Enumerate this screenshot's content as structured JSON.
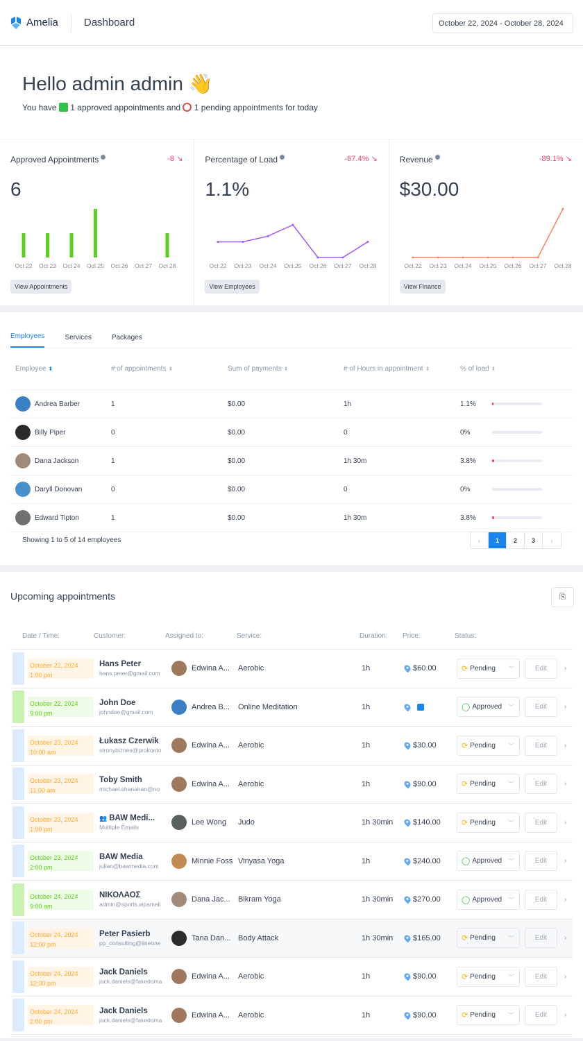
{
  "header": {
    "logo_text": "Amelia",
    "title": "Dashboard",
    "date_range": "October 22, 2024 - October 28, 2024"
  },
  "hello": {
    "greeting": "Hello admin admin",
    "wave": "👋",
    "line_start": "You have",
    "approved_text": "1 approved appointments and",
    "pending_text": "1 pending appointments for today"
  },
  "cards": [
    {
      "title": "Approved Appointments",
      "trend": "-8",
      "value": "6",
      "button": "View Appointments"
    },
    {
      "title": "Percentage of Load",
      "trend": "-67.4%",
      "value": "1.1%",
      "button": "View Employees"
    },
    {
      "title": "Revenue",
      "trend": "-89.1%",
      "value": "$30.00",
      "button": "View Finance"
    }
  ],
  "chart_data": [
    {
      "type": "bar",
      "title": "Approved Appointments",
      "categories": [
        "Oct 22",
        "Oct 23",
        "Oct 24",
        "Oct 25",
        "Oct 26",
        "Oct 27",
        "Oct 28"
      ],
      "values": [
        1,
        1,
        1,
        2,
        0,
        0,
        1
      ],
      "color": "#5fcf1f",
      "ylim": [
        0,
        2
      ]
    },
    {
      "type": "line",
      "title": "Percentage of Load",
      "categories": [
        "Oct 22",
        "Oct 23",
        "Oct 24",
        "Oct 25",
        "Oct 26",
        "Oct 27",
        "Oct 28"
      ],
      "values": [
        1.1,
        1.1,
        1.5,
        2.3,
        0,
        0,
        1.1
      ],
      "color": "#a257f2",
      "ylim": [
        0,
        2.3
      ]
    },
    {
      "type": "line",
      "title": "Revenue",
      "categories": [
        "Oct 22",
        "Oct 23",
        "Oct 24",
        "Oct 25",
        "Oct 26",
        "Oct 27",
        "Oct 28"
      ],
      "values": [
        0,
        0,
        0,
        0,
        0,
        0,
        30
      ],
      "color": "#f7845e",
      "ylim": [
        0,
        30
      ]
    }
  ],
  "employees": {
    "tabs": [
      "Employees",
      "Services",
      "Packages"
    ],
    "columns": [
      "Employee",
      "# of appointments",
      "Sum of payments",
      "# of Hours in appointment",
      "% of load"
    ],
    "rows": [
      {
        "name": "Andrea Barber",
        "appts": "1",
        "sum": "$0.00",
        "hours": "1h",
        "load": "1.1%",
        "load_value": 1.1,
        "avatar": "#3b7fc4"
      },
      {
        "name": "Billy Piper",
        "appts": "0",
        "sum": "$0.00",
        "hours": "0",
        "load": "0%",
        "load_value": 0,
        "avatar": "#2a2a2a"
      },
      {
        "name": "Dana Jackson",
        "appts": "1",
        "sum": "$0.00",
        "hours": "1h 30m",
        "load": "3.8%",
        "load_value": 3.8,
        "avatar": "#a08a7a"
      },
      {
        "name": "Daryll Donovan",
        "appts": "0",
        "sum": "$0.00",
        "hours": "0",
        "load": "0%",
        "load_value": 0,
        "avatar": "#4a90c8"
      },
      {
        "name": "Edward Tipton",
        "appts": "1",
        "sum": "$0.00",
        "hours": "1h 30m",
        "load": "3.8%",
        "load_value": 3.8,
        "avatar": "#707070"
      }
    ],
    "showing": "Showing 1 to 5 of 14 employees",
    "pages": [
      "1",
      "2",
      "3"
    ],
    "prev": "‹",
    "next": "›"
  },
  "upcoming": {
    "title": "Upcoming appointments",
    "columns": [
      "Date / Time:",
      "Customer:",
      "Assigned to:",
      "Service:",
      "Duration:",
      "Price:",
      "Status:"
    ],
    "edit_label": "Edit",
    "rows": [
      {
        "date": "October 22, 2024",
        "time": "1:00 pm",
        "customer": "Hans Peter",
        "email": "hans.peter@gmail.com",
        "employee": "Edwina A...",
        "service": "Aerobic",
        "duration": "1h",
        "price": "$60.00",
        "status": "Pending"
      },
      {
        "date": "October 22, 2024",
        "time": "9:00 pm",
        "customer": "John Doe",
        "email": "johndoe@gmail.com",
        "employee": "Andrea B...",
        "service": "Online Meditation",
        "duration": "1h",
        "price": "",
        "status": "Approved"
      },
      {
        "date": "October 23, 2024",
        "time": "10:00 am",
        "customer": "Łukasz Czerwik",
        "email": "stronybiznes@prokonto",
        "employee": "Edwina A...",
        "service": "Aerobic",
        "duration": "1h",
        "price": "$30.00",
        "status": "Pending"
      },
      {
        "date": "October 23, 2024",
        "time": "11:00 am",
        "customer": "Toby Smith",
        "email": "michael.shanahan@no",
        "employee": "Edwina A...",
        "service": "Aerobic",
        "duration": "1h",
        "price": "$90.00",
        "status": "Pending"
      },
      {
        "date": "October 23, 2024",
        "time": "1:00 pm",
        "customer": "BAW Medi...",
        "email": "Multiple Emails",
        "employee": "Lee Wong",
        "service": "Judo",
        "duration": "1h 30min",
        "price": "$140.00",
        "status": "Pending",
        "group": true
      },
      {
        "date": "October 23, 2024",
        "time": "2:00 pm",
        "customer": "BAW Media",
        "email": "julian@bawmedia.com",
        "employee": "Minnie Foss",
        "service": "Vinyasa Yoga",
        "duration": "1h",
        "price": "$240.00",
        "status": "Approved"
      },
      {
        "date": "October 24, 2024",
        "time": "9:00 am",
        "customer": "ΝΙΚΟΛΑΟΣ",
        "email": "admin@sports.wpameli",
        "employee": "Dana Jac...",
        "service": "Bikram Yoga",
        "duration": "1h 30min",
        "price": "$270.00",
        "status": "Approved"
      },
      {
        "date": "October 24, 2024",
        "time": "12:00 pm",
        "customer": "Peter Pasierb",
        "email": "pp_consulting@lineone",
        "employee": "Tana Dan...",
        "service": "Body Attack",
        "duration": "1h 30min",
        "price": "$165.00",
        "status": "Pending"
      },
      {
        "date": "October 24, 2024",
        "time": "12:30 pm",
        "customer": "Jack Daniels",
        "email": "jack.daniels@fakedoma",
        "employee": "Edwina A...",
        "service": "Aerobic",
        "duration": "1h",
        "price": "$90.00",
        "status": "Pending"
      },
      {
        "date": "October 24, 2024",
        "time": "2:00 pm",
        "customer": "Jack Daniels",
        "email": "jack.daniels@fakedoma",
        "employee": "Edwina A...",
        "service": "Aerobic",
        "duration": "1h",
        "price": "$90.00",
        "status": "Pending"
      }
    ]
  }
}
